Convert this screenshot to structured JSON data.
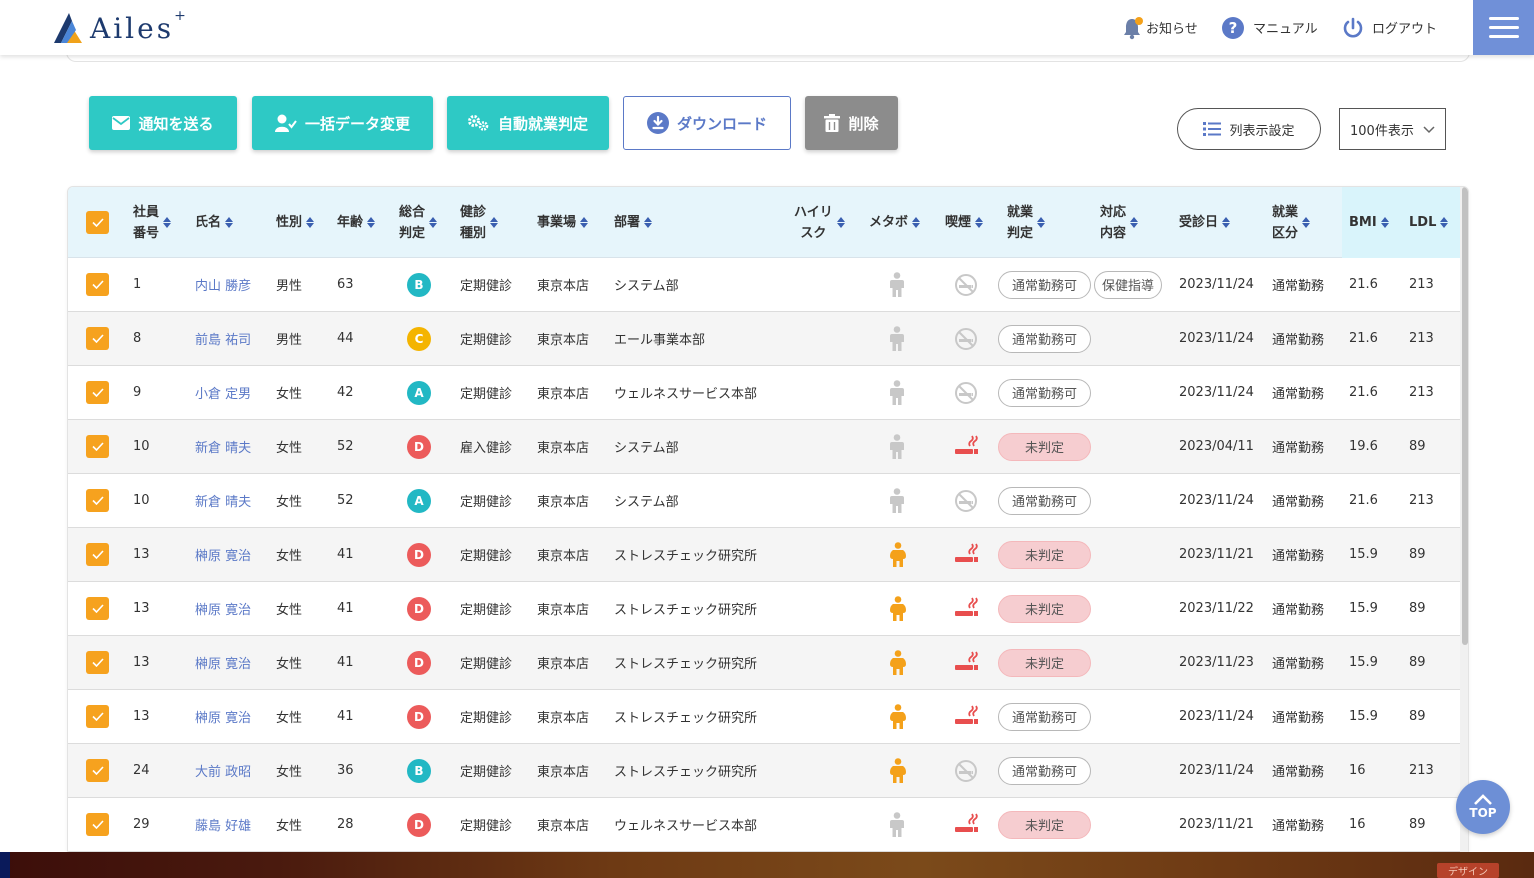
{
  "header": {
    "logo_text": "Ailes",
    "logo_plus": "+",
    "notice_label": "お知らせ",
    "manual_label": "マニュアル",
    "logout_label": "ログアウト"
  },
  "toolbar": {
    "notify_label": "通知を送る",
    "bulk_change_label": "一括データ変更",
    "auto_judge_label": "自動就業判定",
    "download_label": "ダウンロード",
    "delete_label": "削除",
    "column_setting_label": "列表示設定",
    "per_page_value": "100件表示"
  },
  "table": {
    "headers": {
      "emp_no": [
        "社員",
        "番号"
      ],
      "name": "氏名",
      "gender": "性別",
      "age": "年齢",
      "overall": [
        "総合",
        "判定"
      ],
      "exam_type": [
        "健診",
        "種別"
      ],
      "office": "事業場",
      "dept": "部署",
      "high_risk": [
        "ハイリ",
        "スク"
      ],
      "metabo": "メタボ",
      "smoking": "喫煙",
      "work_judge": [
        "就業",
        "判定"
      ],
      "response": [
        "対応",
        "内容"
      ],
      "exam_date": "受診日",
      "work_class": [
        "就業",
        "区分"
      ],
      "bmi": "BMI",
      "ldl": "LDL"
    },
    "rows": [
      {
        "emp_no": "1",
        "name": "内山 勝彦",
        "gender": "男性",
        "age": "63",
        "grade": "B",
        "exam_type": "定期健診",
        "office": "東京本店",
        "dept": "システム部",
        "metabo": false,
        "smoker": false,
        "judge": "通常勤務可",
        "judge_status": "ok",
        "response": "保健指導",
        "exam_date": "2023/11/24",
        "work_class": "通常勤務",
        "bmi": "21.6",
        "ldl": "213"
      },
      {
        "emp_no": "8",
        "name": "前島 祐司",
        "gender": "男性",
        "age": "44",
        "grade": "C",
        "exam_type": "定期健診",
        "office": "東京本店",
        "dept": "エール事業本部",
        "metabo": false,
        "smoker": false,
        "judge": "通常勤務可",
        "judge_status": "ok",
        "response": "",
        "exam_date": "2023/11/24",
        "work_class": "通常勤務",
        "bmi": "21.6",
        "ldl": "213"
      },
      {
        "emp_no": "9",
        "name": "小倉 定男",
        "gender": "女性",
        "age": "42",
        "grade": "A",
        "exam_type": "定期健診",
        "office": "東京本店",
        "dept": "ウェルネスサービス本部",
        "metabo": false,
        "smoker": false,
        "judge": "通常勤務可",
        "judge_status": "ok",
        "response": "",
        "exam_date": "2023/11/24",
        "work_class": "通常勤務",
        "bmi": "21.6",
        "ldl": "213"
      },
      {
        "emp_no": "10",
        "name": "新倉 晴夫",
        "gender": "女性",
        "age": "52",
        "grade": "D",
        "exam_type": "雇入健診",
        "office": "東京本店",
        "dept": "システム部",
        "metabo": false,
        "smoker": true,
        "judge": "未判定",
        "judge_status": "ng",
        "response": "",
        "exam_date": "2023/04/11",
        "work_class": "通常勤務",
        "bmi": "19.6",
        "ldl": "89"
      },
      {
        "emp_no": "10",
        "name": "新倉 晴夫",
        "gender": "女性",
        "age": "52",
        "grade": "A",
        "exam_type": "定期健診",
        "office": "東京本店",
        "dept": "システム部",
        "metabo": false,
        "smoker": false,
        "judge": "通常勤務可",
        "judge_status": "ok",
        "response": "",
        "exam_date": "2023/11/24",
        "work_class": "通常勤務",
        "bmi": "21.6",
        "ldl": "213"
      },
      {
        "emp_no": "13",
        "name": "榊原 寛治",
        "gender": "女性",
        "age": "41",
        "grade": "D",
        "exam_type": "定期健診",
        "office": "東京本店",
        "dept": "ストレスチェック研究所",
        "metabo": true,
        "smoker": true,
        "judge": "未判定",
        "judge_status": "ng",
        "response": "",
        "exam_date": "2023/11/21",
        "work_class": "通常勤務",
        "bmi": "15.9",
        "ldl": "89"
      },
      {
        "emp_no": "13",
        "name": "榊原 寛治",
        "gender": "女性",
        "age": "41",
        "grade": "D",
        "exam_type": "定期健診",
        "office": "東京本店",
        "dept": "ストレスチェック研究所",
        "metabo": true,
        "smoker": true,
        "judge": "未判定",
        "judge_status": "ng",
        "response": "",
        "exam_date": "2023/11/22",
        "work_class": "通常勤務",
        "bmi": "15.9",
        "ldl": "89"
      },
      {
        "emp_no": "13",
        "name": "榊原 寛治",
        "gender": "女性",
        "age": "41",
        "grade": "D",
        "exam_type": "定期健診",
        "office": "東京本店",
        "dept": "ストレスチェック研究所",
        "metabo": true,
        "smoker": true,
        "judge": "未判定",
        "judge_status": "ng",
        "response": "",
        "exam_date": "2023/11/23",
        "work_class": "通常勤務",
        "bmi": "15.9",
        "ldl": "89"
      },
      {
        "emp_no": "13",
        "name": "榊原 寛治",
        "gender": "女性",
        "age": "41",
        "grade": "D",
        "exam_type": "定期健診",
        "office": "東京本店",
        "dept": "ストレスチェック研究所",
        "metabo": true,
        "smoker": true,
        "judge": "通常勤務可",
        "judge_status": "ok",
        "response": "",
        "exam_date": "2023/11/24",
        "work_class": "通常勤務",
        "bmi": "15.9",
        "ldl": "89"
      },
      {
        "emp_no": "24",
        "name": "大前 政昭",
        "gender": "女性",
        "age": "36",
        "grade": "B",
        "exam_type": "定期健診",
        "office": "東京本店",
        "dept": "ストレスチェック研究所",
        "metabo": true,
        "smoker": false,
        "judge": "通常勤務可",
        "judge_status": "ok",
        "response": "",
        "exam_date": "2023/11/24",
        "work_class": "通常勤務",
        "bmi": "16",
        "ldl": "213"
      },
      {
        "emp_no": "29",
        "name": "藤島 好雄",
        "gender": "女性",
        "age": "28",
        "grade": "D",
        "exam_type": "定期健診",
        "office": "東京本店",
        "dept": "ウェルネスサービス本部",
        "metabo": false,
        "smoker": true,
        "judge": "未判定",
        "judge_status": "ng",
        "response": "",
        "exam_date": "2023/11/21",
        "work_class": "通常勤務",
        "bmi": "16",
        "ldl": "89"
      }
    ]
  },
  "grade_colors": {
    "A": "#22b8c4",
    "B": "#22b8c4",
    "C": "#f4b400",
    "D": "#ec5b5b"
  },
  "top_button_label": "TOP",
  "footer_tag": "デザイン"
}
